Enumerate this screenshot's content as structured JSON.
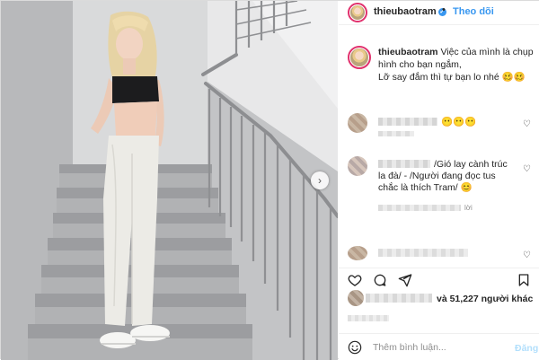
{
  "header": {
    "username": "thieubaotram",
    "verified_icon": "verified-badge-icon",
    "separator": "•",
    "follow_label": "Theo dõi"
  },
  "caption": {
    "username": "thieubaotram",
    "line1": "Việc của mình là chụp hình cho bạn ngắm,",
    "line2": "Lỡ say đắm thì tự bạn lo nhé 🥴🥴"
  },
  "comments": [
    {
      "text": "😶😶😶"
    },
    {
      "text": "/Gió lay cành trúc la đà/ - /Người đang đọc tus chắc là thích Tram/ 😊"
    }
  ],
  "reply_label": "lời",
  "likes": {
    "text": "và 51,227 người khác"
  },
  "add_comment": {
    "placeholder": "Thêm bình luận...",
    "post_label": "Đăng"
  },
  "colors": {
    "link_blue": "#3897f0",
    "post_disabled": "#b2dffc",
    "border": "#dbdbdb",
    "text": "#262626",
    "muted": "#8e8e8e"
  },
  "icons": {
    "like": "heart-icon",
    "comment": "comment-icon",
    "share": "share-icon",
    "save": "bookmark-icon",
    "emoji": "emoji-icon",
    "next": "chevron-right-icon"
  }
}
